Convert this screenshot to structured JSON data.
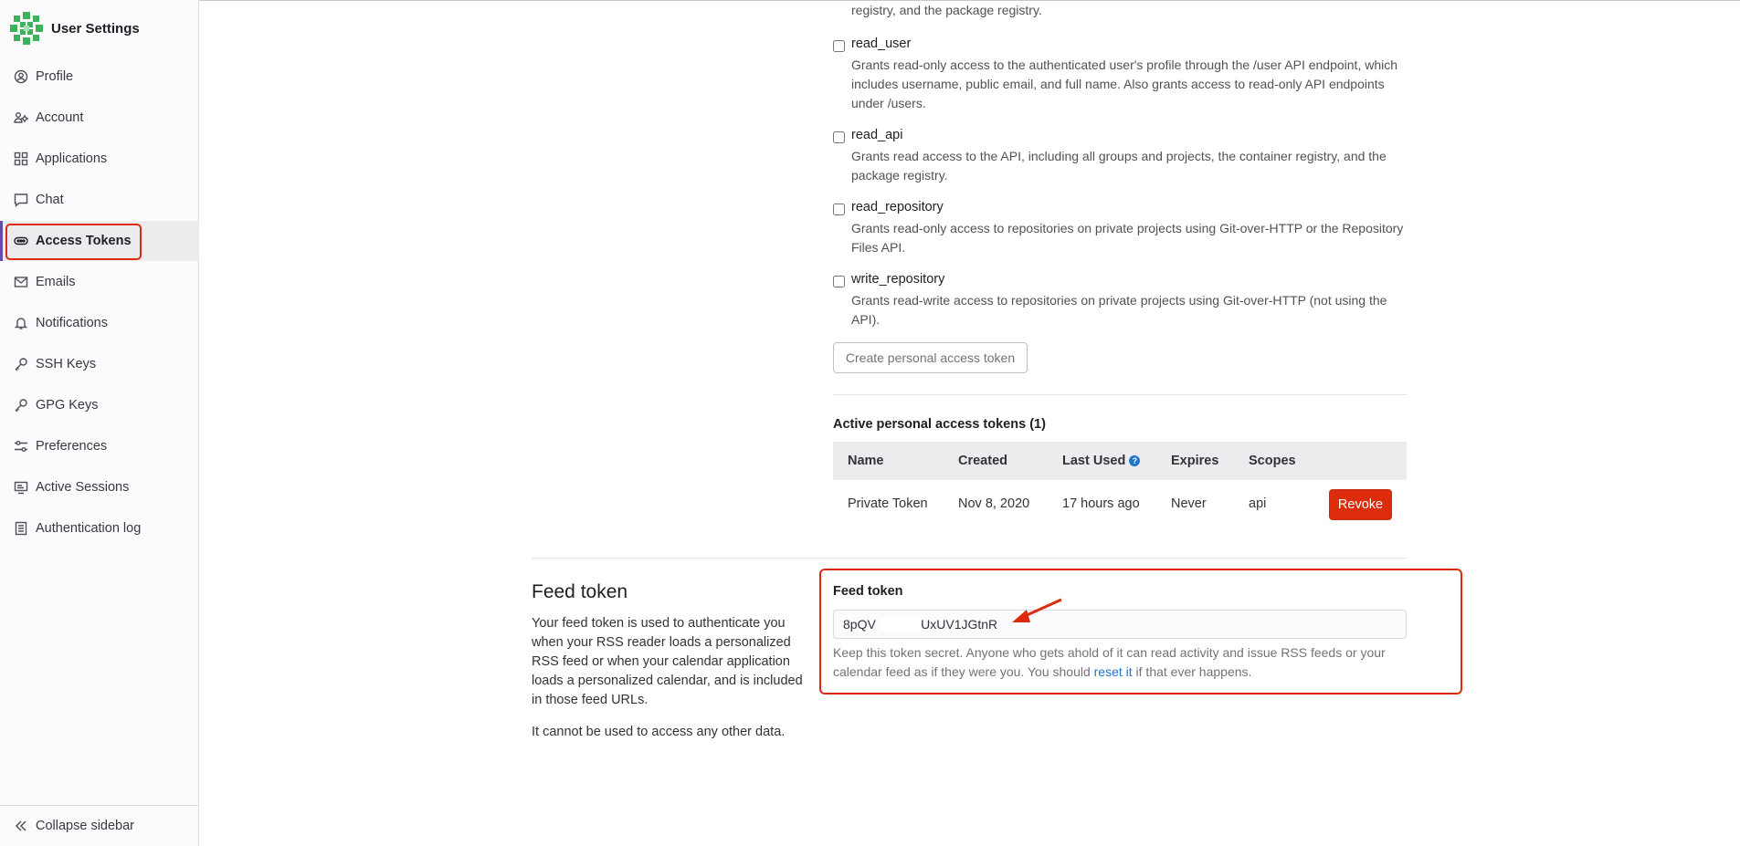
{
  "sidebar": {
    "title": "User Settings",
    "items": [
      {
        "label": "Profile",
        "icon": "profile-icon"
      },
      {
        "label": "Account",
        "icon": "account-icon"
      },
      {
        "label": "Applications",
        "icon": "applications-icon"
      },
      {
        "label": "Chat",
        "icon": "chat-icon"
      },
      {
        "label": "Access Tokens",
        "icon": "token-icon"
      },
      {
        "label": "Emails",
        "icon": "mail-icon"
      },
      {
        "label": "Notifications",
        "icon": "bell-icon"
      },
      {
        "label": "SSH Keys",
        "icon": "key-icon"
      },
      {
        "label": "GPG Keys",
        "icon": "key-icon"
      },
      {
        "label": "Preferences",
        "icon": "preferences-icon"
      },
      {
        "label": "Active Sessions",
        "icon": "monitor-icon"
      },
      {
        "label": "Authentication log",
        "icon": "log-icon"
      }
    ],
    "active": "Access Tokens",
    "collapse_label": "Collapse sidebar"
  },
  "scopes": {
    "top_desc": "registry, and the package registry.",
    "items": [
      {
        "name": "read_user",
        "desc": "Grants read-only access to the authenticated user's profile through the /user API endpoint, which includes username, public email, and full name. Also grants access to read-only API endpoints under /users."
      },
      {
        "name": "read_api",
        "desc": "Grants read access to the API, including all groups and projects, the container registry, and the package registry."
      },
      {
        "name": "read_repository",
        "desc": "Grants read-only access to repositories on private projects using Git-over-HTTP or the Repository Files API."
      },
      {
        "name": "write_repository",
        "desc": "Grants read-write access to repositories on private projects using Git-over-HTTP (not using the API)."
      }
    ],
    "create_button": "Create personal access token"
  },
  "active_tokens": {
    "title": "Active personal access tokens (1)",
    "headers": [
      "Name",
      "Created",
      "Last Used",
      "Expires",
      "Scopes"
    ],
    "rows": [
      {
        "name": "Private Token",
        "created": "Nov 8, 2020",
        "last_used": "17 hours ago",
        "expires": "Never",
        "scopes": "api"
      }
    ],
    "revoke_label": "Revoke"
  },
  "feed": {
    "heading": "Feed token",
    "description": "Your feed token is used to authenticate you when your RSS reader loads a personalized RSS feed or when your calendar application loads a personalized calendar, and is included in those feed URLs.",
    "description2": "It cannot be used to access any other data.",
    "label": "Feed token",
    "value": "8pQV            'UxUV1JGtnR",
    "help_before": "Keep this token secret. Anyone who gets ahold of it can read activity and issue RSS feeds or your calendar feed as if they were you. You should ",
    "help_link": "reset it",
    "help_after": " if that ever happens."
  },
  "colors": {
    "accent_red": "#dd2b0e",
    "link_blue": "#1f75cb",
    "active_bar": "#5f4fa8"
  }
}
